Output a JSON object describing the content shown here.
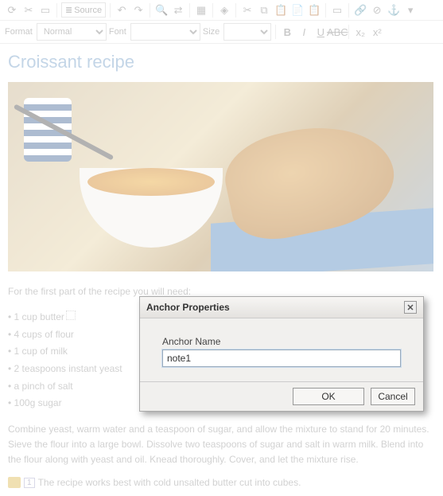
{
  "toolbar1": {
    "source_label": "Source"
  },
  "toolbar2": {
    "format_label": "Format",
    "format_value": "Normal",
    "font_label": "Font",
    "font_value": "",
    "size_label": "Size",
    "size_value": ""
  },
  "document": {
    "title": "Croissant recipe",
    "intro": "For the first part of the recipe you will need:",
    "ingredients": [
      "1 cup butter",
      "4 cups of flour",
      "1 cup of milk",
      "2 teaspoons instant yeast",
      "a pinch of salt",
      "100g sugar"
    ],
    "body": "Combine yeast, warm water and a teaspoon of sugar, and allow the mixture to stand for 20 minutes. Sieve the flour into a large bowl. Dissolve two teaspoons of sugar and salt in warm milk. Blend into the flour along with yeast and oil. Knead thoroughly. Cover, and let the mixture rise.",
    "footnote_num": "1",
    "footnote_text": "The recipe works best with cold unsalted butter cut into cubes."
  },
  "dialog": {
    "title": "Anchor Properties",
    "field_label": "Anchor Name",
    "field_value": "note1",
    "ok": "OK",
    "cancel": "Cancel"
  }
}
